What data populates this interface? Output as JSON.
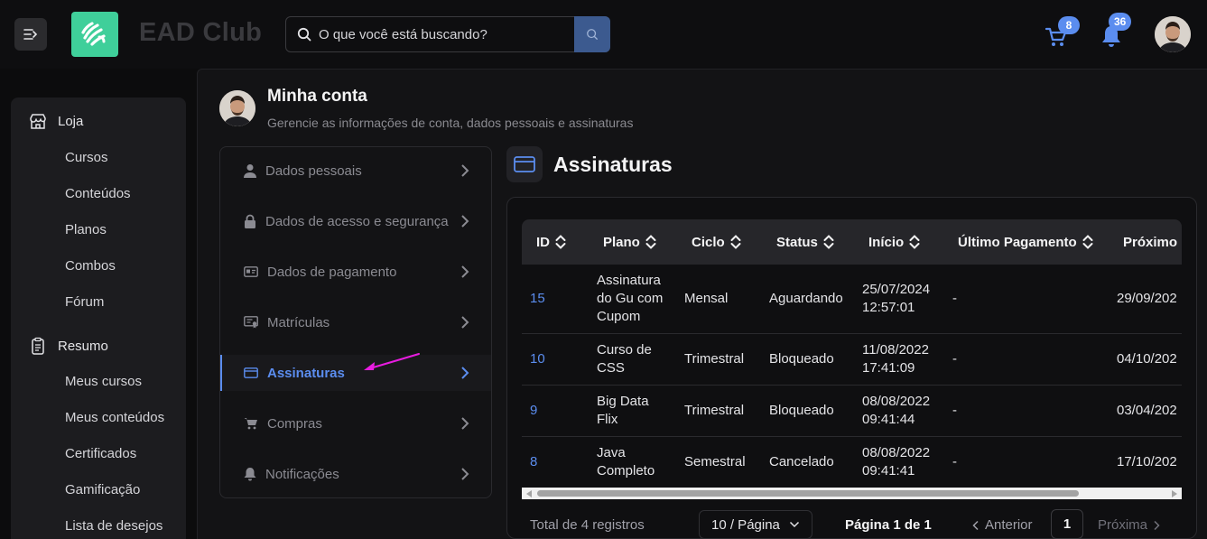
{
  "header": {
    "brand": "EAD Club",
    "search_placeholder": "O que você está buscando?",
    "cart_count": "8",
    "notification_count": "36"
  },
  "sidebar": {
    "sections": [
      {
        "label": "Loja",
        "icon": "store-icon",
        "items": [
          "Cursos",
          "Conteúdos",
          "Planos",
          "Combos",
          "Fórum"
        ]
      },
      {
        "label": "Resumo",
        "icon": "clipboard-icon",
        "items": [
          "Meus cursos",
          "Meus conteúdos",
          "Certificados",
          "Gamificação",
          "Lista de desejos"
        ]
      }
    ]
  },
  "page": {
    "title": "Minha conta",
    "subtitle": "Gerencie as informações de conta, dados pessoais e assinaturas"
  },
  "account_menu": [
    {
      "label": "Dados pessoais",
      "icon": "user-icon",
      "active": false
    },
    {
      "label": "Dados de acesso e segurança",
      "icon": "lock-icon",
      "active": false
    },
    {
      "label": "Dados de pagamento",
      "icon": "id-card-icon",
      "active": false
    },
    {
      "label": "Matrículas",
      "icon": "certificate-icon",
      "active": false
    },
    {
      "label": "Assinaturas",
      "icon": "credit-card-icon",
      "active": true
    },
    {
      "label": "Compras",
      "icon": "cart-icon",
      "active": false
    },
    {
      "label": "Notificações",
      "icon": "bell-icon",
      "active": false
    }
  ],
  "section": {
    "title": "Assinaturas",
    "icon": "credit-card-icon"
  },
  "table": {
    "columns": [
      "ID",
      "Plano",
      "Ciclo",
      "Status",
      "Início",
      "Último Pagamento",
      "Próximo P"
    ],
    "rows": [
      {
        "id": "15",
        "plano": [
          "Assinatura",
          "do Gu com",
          "Cupom"
        ],
        "ciclo": "Mensal",
        "status": "Aguardando",
        "inicio": [
          "25/07/2024",
          "12:57:01"
        ],
        "ultimo": "-",
        "proximo": "29/09/202"
      },
      {
        "id": "10",
        "plano": [
          "Curso de",
          "CSS"
        ],
        "ciclo": "Trimestral",
        "status": "Bloqueado",
        "inicio": [
          "11/08/2022",
          "17:41:09"
        ],
        "ultimo": "-",
        "proximo": "04/10/202"
      },
      {
        "id": "9",
        "plano": [
          "Big Data",
          "Flix"
        ],
        "ciclo": "Trimestral",
        "status": "Bloqueado",
        "inicio": [
          "08/08/2022",
          "09:41:44"
        ],
        "ultimo": "-",
        "proximo": "03/04/202"
      },
      {
        "id": "8",
        "plano": [
          "Java",
          "Completo"
        ],
        "ciclo": "Semestral",
        "status": "Cancelado",
        "inicio": [
          "08/08/2022",
          "09:41:41"
        ],
        "ultimo": "-",
        "proximo": "17/10/202"
      }
    ]
  },
  "pagination": {
    "total": "Total de 4 registros",
    "page_size": "10 / Página",
    "page_info": "Página 1 de 1",
    "prev": "Anterior",
    "current": "1",
    "next": "Próxima"
  },
  "colors": {
    "accent": "#5b8def",
    "logo": "#3fcf9a",
    "annotation_arrow": "#e81ce0"
  }
}
